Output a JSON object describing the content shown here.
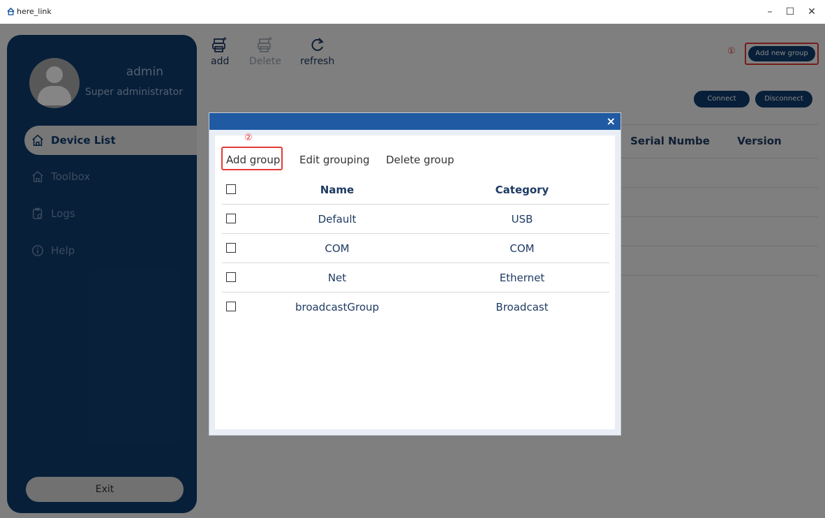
{
  "window": {
    "title": "here_link",
    "minimize": "–",
    "maximize": "☐",
    "close": "✕"
  },
  "user": {
    "name": "admin",
    "role": "Super administrator"
  },
  "sidebar": {
    "items": [
      {
        "label": "Device List",
        "icon": "home-icon",
        "active": true
      },
      {
        "label": "Toolbox",
        "icon": "toolbox-icon"
      },
      {
        "label": "Logs",
        "icon": "clipboard-icon"
      },
      {
        "label": "Help",
        "icon": "info-icon"
      }
    ],
    "exit_label": "Exit"
  },
  "toolbar": {
    "add_label": "add",
    "delete_label": "Delete",
    "refresh_label": "refresh"
  },
  "actions": {
    "add_new_group": "Add new group",
    "connect": "Connect",
    "disconnect": "Disconnect",
    "annotation_1": "①",
    "annotation_2": "②"
  },
  "device_table": {
    "headers": [
      "Serial Numbe",
      "Version"
    ]
  },
  "dialog": {
    "close": "×",
    "tabs": [
      "Add group",
      "Edit grouping",
      "Delete group"
    ],
    "columns": {
      "name": "Name",
      "category": "Category"
    },
    "rows": [
      {
        "name": "Default",
        "category": "USB"
      },
      {
        "name": "COM",
        "category": "COM"
      },
      {
        "name": "Net",
        "category": "Ethernet"
      },
      {
        "name": "broadcastGroup",
        "category": "Broadcast"
      }
    ]
  },
  "colors": {
    "primary": "#0f3d6e",
    "dialog_header": "#1f5aa3",
    "highlight": "#e53935"
  }
}
